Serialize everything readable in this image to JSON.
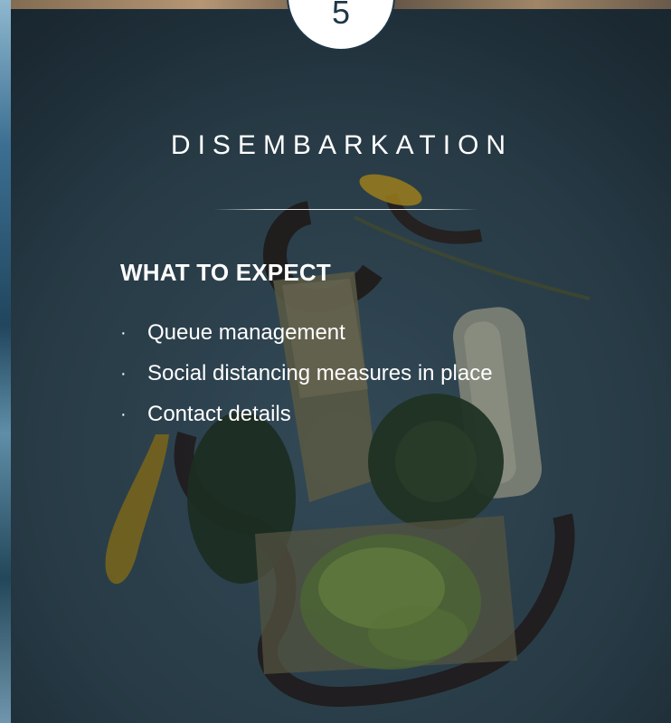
{
  "step_number": "5",
  "title": "DISEMBARKATION",
  "subtitle": "WHAT TO EXPECT",
  "bullet_glyph": "·",
  "items": [
    "Queue management",
    "Social distancing measures in place",
    "Contact details"
  ],
  "colors": {
    "text": "#ffffff",
    "circle_fill": "#ffffff",
    "circle_border": "#1e3746",
    "background": "#2b3f49"
  }
}
